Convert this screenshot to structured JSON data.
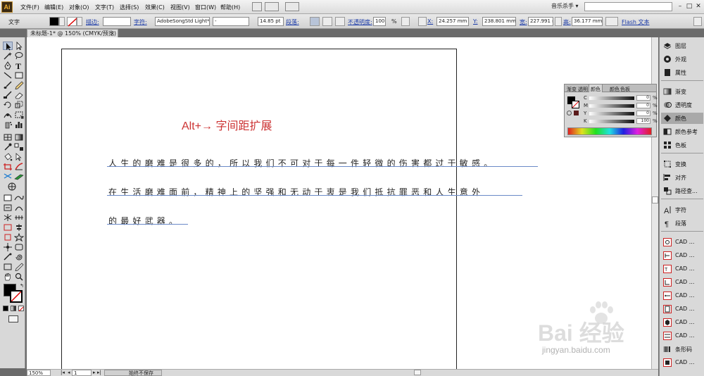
{
  "menubar": {
    "logo": "Ai",
    "items": [
      "文件(F)",
      "编辑(E)",
      "对象(O)",
      "文字(T)",
      "选择(S)",
      "效果(C)",
      "视图(V)",
      "窗口(W)",
      "帮助(H)"
    ],
    "workspace": "音乐杀手 ▾"
  },
  "controlbar": {
    "mode_label": "文字",
    "stroke_label": "描边:",
    "char_label": "字符:",
    "font_value": "AdobeSongStd Light*",
    "style_value": "-",
    "size_value": "14.85 pt",
    "para_label": "段落:",
    "opacity_label": "不透明度:",
    "opacity_value": "100",
    "opacity_unit": "%",
    "x_label": "X:",
    "x_value": "24.257 mm",
    "y_label": "Y:",
    "y_value": "238.801 mm",
    "w_label": "宽:",
    "w_value": "227.991 m",
    "h_label": "高:",
    "h_value": "36.177 mm",
    "flash_label": "Flash 文本"
  },
  "document": {
    "tab_title": "未标题-1* @ 150% (CMYK/预览)",
    "heading": "Alt+→ 字间距扩展",
    "lines": [
      "人生的磨难是很多的，所以我们不可对于每一件轻微的伤害都过于敏感。",
      "在生活磨难面前，精神上的坚强和无动于衷是我们抵抗罪恶和人生意外",
      "的最好武器。"
    ]
  },
  "statusbar": {
    "zoom": "150%",
    "page": "1",
    "status": "始终不保存"
  },
  "color_panel": {
    "tabs": [
      "渐变",
      "透明",
      "颜色",
      "颜色",
      "色板"
    ],
    "channels": [
      {
        "name": "C",
        "value": "0",
        "unit": "%"
      },
      {
        "name": "M",
        "value": "0",
        "unit": "%"
      },
      {
        "name": "Y",
        "value": "0",
        "unit": "%"
      },
      {
        "name": "K",
        "value": "100",
        "unit": "%"
      }
    ]
  },
  "dock": {
    "items": [
      "图层",
      "外观",
      "属性",
      "渐变",
      "透明度",
      "颜色",
      "颜色参考",
      "色板",
      "变换",
      "对齐",
      "路径查...",
      "字符",
      "段落",
      "CAD ...",
      "CAD ...",
      "CAD ...",
      "CAD ...",
      "CAD ...",
      "CAD ...",
      "CAD ...",
      "CAD ...",
      "条形码",
      "CAD ..."
    ]
  },
  "watermark": {
    "text": "Bai 经验",
    "url": "jingyan.baidu.com"
  },
  "colors": {
    "heading": "#cc3333",
    "underline": "#6a8ac8",
    "canvas": "#ffffff",
    "chrome": "#d9d9d9"
  }
}
